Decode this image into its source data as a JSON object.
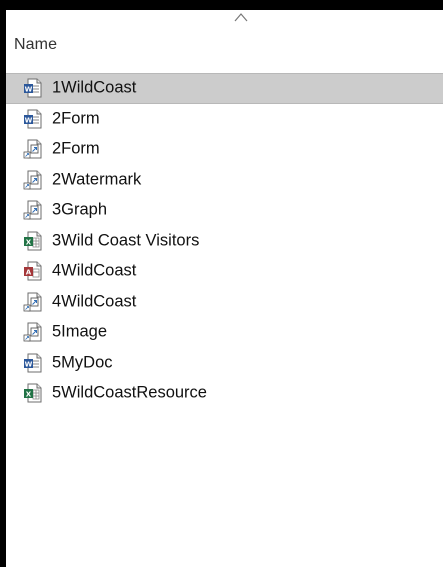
{
  "header": {
    "column_label": "Name",
    "sort_indicator_icon": "sort-ascending-chevron-icon"
  },
  "files": [
    {
      "name": "1WildCoast",
      "icon": "word-document-icon",
      "selected": true
    },
    {
      "name": "2Form",
      "icon": "word-document-icon",
      "selected": false
    },
    {
      "name": "2Form",
      "icon": "generic-document-icon",
      "selected": false
    },
    {
      "name": "2Watermark",
      "icon": "generic-document-icon",
      "selected": false
    },
    {
      "name": "3Graph",
      "icon": "generic-document-icon",
      "selected": false
    },
    {
      "name": "3Wild Coast Visitors",
      "icon": "excel-spreadsheet-icon",
      "selected": false
    },
    {
      "name": "4WildCoast",
      "icon": "access-database-icon",
      "selected": false
    },
    {
      "name": "4WildCoast",
      "icon": "generic-document-icon",
      "selected": false
    },
    {
      "name": "5Image",
      "icon": "generic-document-icon",
      "selected": false
    },
    {
      "name": "5MyDoc",
      "icon": "word-document-icon",
      "selected": false
    },
    {
      "name": "5WildCoastResource",
      "icon": "excel-spreadsheet-icon",
      "selected": false
    }
  ],
  "colors": {
    "selection_background": "#cccccc",
    "word_blue": "#2b579a",
    "excel_green": "#217346",
    "access_red": "#a4373a"
  }
}
